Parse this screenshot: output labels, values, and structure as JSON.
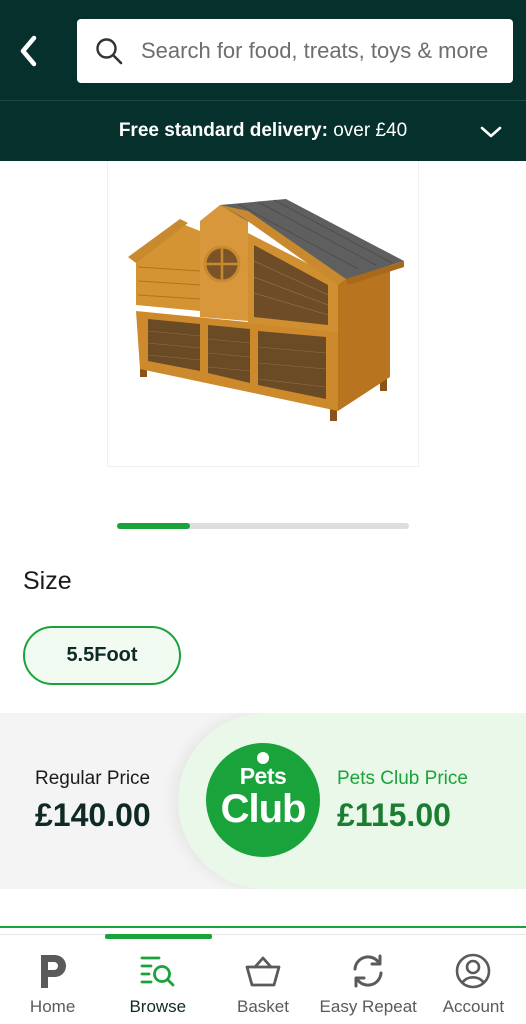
{
  "header": {
    "back_icon": "chevron-left-icon",
    "search_placeholder": "Search for food, treats, toys & more",
    "search_icon": "search-icon"
  },
  "delivery_banner": {
    "bold": "Free standard delivery:",
    "rest": " over £40",
    "chevron_icon": "chevron-down-icon"
  },
  "gallery": {
    "progress_fraction": 0.25
  },
  "size": {
    "label": "Size",
    "options": [
      "5.5Foot"
    ]
  },
  "pricing": {
    "regular_label": "Regular Price",
    "regular_value": "£140.00",
    "logo_line1": "Pets",
    "logo_line2": "Club",
    "club_label": "Pets Club Price",
    "club_value": "£115.00"
  },
  "bottom_nav": {
    "items": [
      {
        "label": "Home",
        "icon": "home-icon"
      },
      {
        "label": "Browse",
        "icon": "browse-icon"
      },
      {
        "label": "Basket",
        "icon": "basket-icon"
      },
      {
        "label": "Easy Repeat",
        "icon": "easy-repeat-icon"
      },
      {
        "label": "Account",
        "icon": "account-icon"
      }
    ],
    "active_index": 1
  },
  "colors": {
    "header_bg": "#06302b",
    "brand_green": "#1aa33a",
    "dark_text": "#0f2a26"
  }
}
